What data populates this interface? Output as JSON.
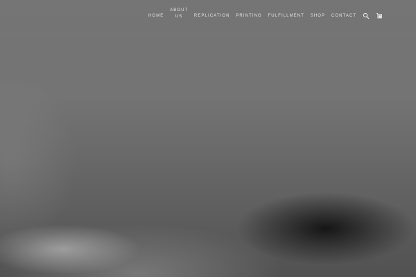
{
  "nav": {
    "items": [
      {
        "label": "HOME"
      },
      {
        "label": "ABOUT US"
      },
      {
        "label": "REPLICATION"
      },
      {
        "label": "PRINTING"
      },
      {
        "label": "FULFILLMENT"
      },
      {
        "label": "SHOP"
      },
      {
        "label": "CONTACT"
      }
    ],
    "icons": {
      "search": "search-icon",
      "cart": "cart-icon"
    }
  },
  "colors": {
    "nav_text": "#e6e6e6",
    "background": "#7f7f7f"
  }
}
